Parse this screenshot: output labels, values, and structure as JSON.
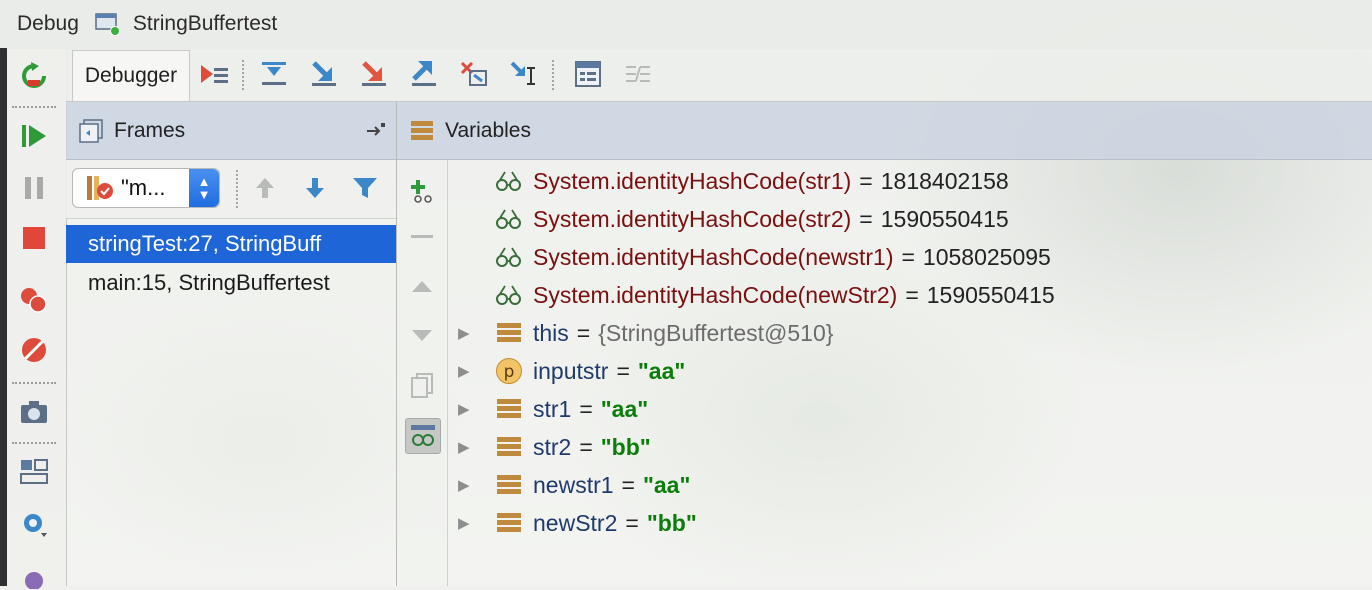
{
  "window": {
    "debug_label": "Debug",
    "config_name": "StringBuffertest"
  },
  "tabs": {
    "debugger_label": "Debugger"
  },
  "frames": {
    "header": "Frames",
    "thread_selector": "\"m...",
    "rows": [
      "stringTest:27, StringBuff",
      "main:15, StringBuffertest"
    ]
  },
  "variables": {
    "header": "Variables",
    "watches": [
      {
        "expr": "System.identityHashCode(str1)",
        "value": "1818402158"
      },
      {
        "expr": "System.identityHashCode(str2)",
        "value": "1590550415"
      },
      {
        "expr": "System.identityHashCode(newstr1)",
        "value": "1058025095"
      },
      {
        "expr": "System.identityHashCode(newStr2)",
        "value": "1590550415"
      }
    ],
    "vars": [
      {
        "name": "this",
        "value": "{StringBuffertest@510}",
        "kind": "object"
      },
      {
        "name": "inputstr",
        "value": "\"aa\"",
        "kind": "param",
        "badge": "p"
      },
      {
        "name": "str1",
        "value": "\"aa\"",
        "kind": "field"
      },
      {
        "name": "str2",
        "value": "\"bb\"",
        "kind": "field"
      },
      {
        "name": "newstr1",
        "value": "\"aa\"",
        "kind": "field"
      },
      {
        "name": "newStr2",
        "value": "\"bb\"",
        "kind": "field"
      }
    ]
  },
  "colors": {
    "selection": "#1e66d8",
    "header_bg": "#cad4e0",
    "string_value": "#0a7d0a",
    "watch_name": "#7a1010"
  }
}
